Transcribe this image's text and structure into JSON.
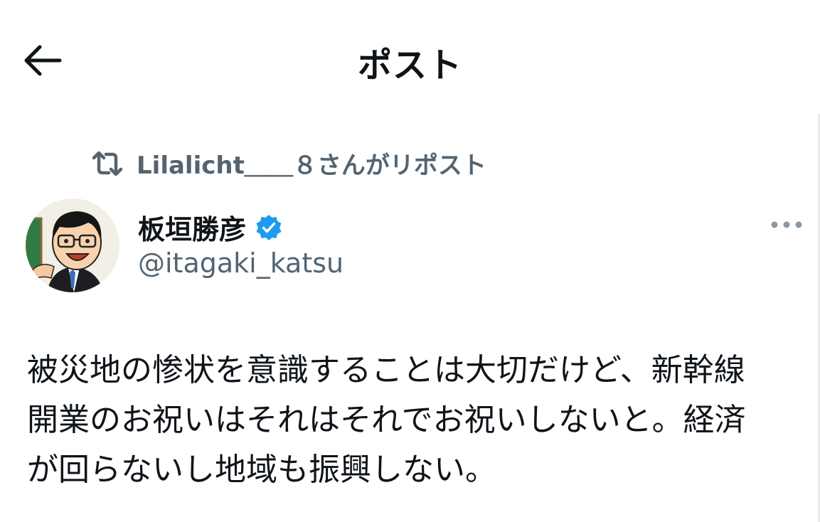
{
  "header": {
    "title": "ポスト",
    "back_icon": "arrow-left-icon"
  },
  "repost": {
    "icon": "repost-icon",
    "text": "Lilalicht＿＿８さんがリポスト"
  },
  "author": {
    "display_name": "板垣勝彦",
    "verified": true,
    "verified_color": "#1d9bf0",
    "handle": "@itagaki_katsu"
  },
  "post": {
    "text": "被災地の惨状を意識することは大切だけど、新幹線\n開業のお祝いはそれはそれでお祝いしないと。経済\nが回らないし地域も振興しない。"
  },
  "colors": {
    "text_primary": "#0f1419",
    "text_secondary": "#536471"
  }
}
